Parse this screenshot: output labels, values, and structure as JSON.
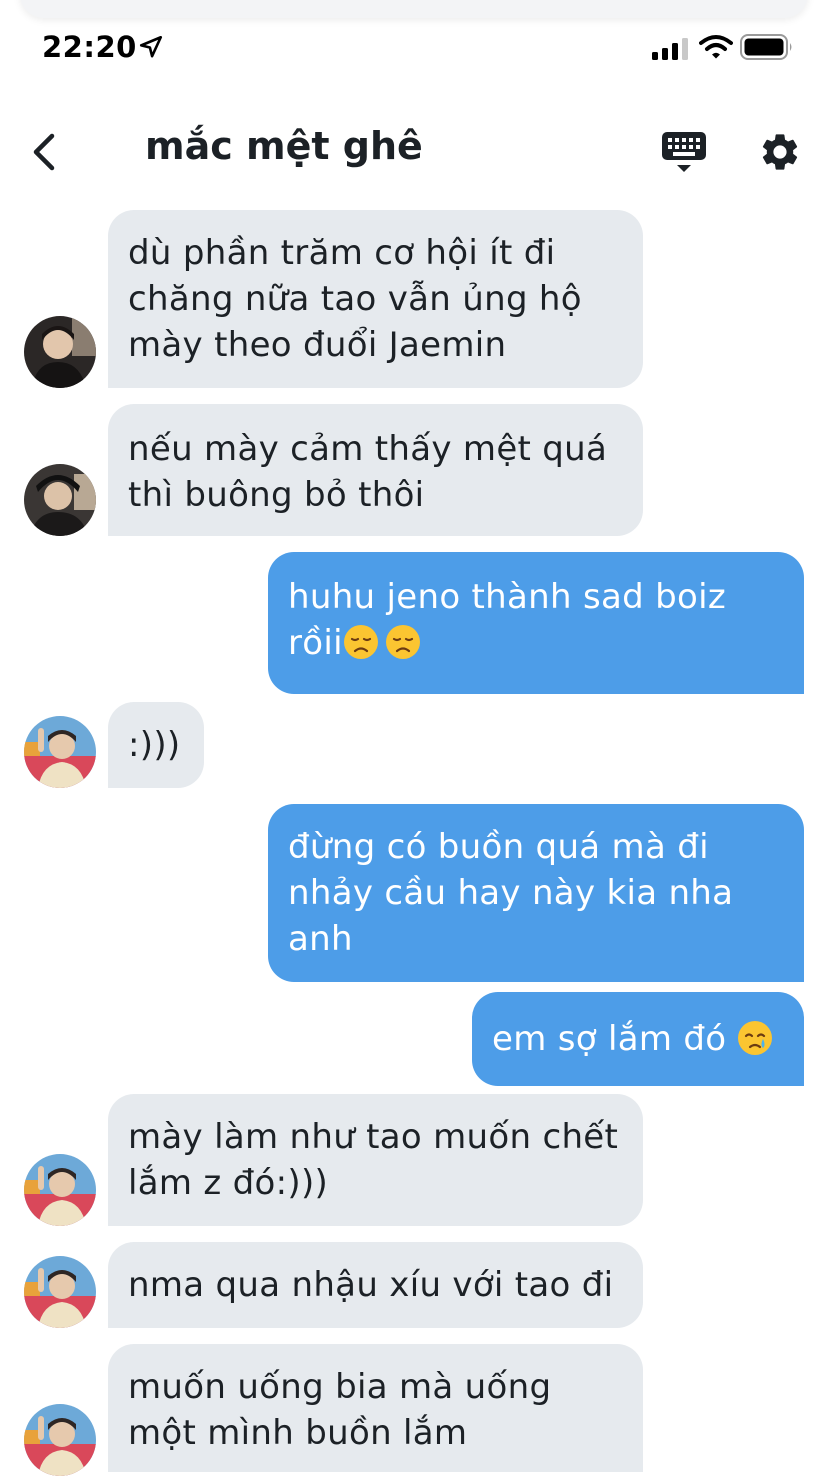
{
  "status_bar": {
    "time": "22:20",
    "location_icon": "location-arrow-icon",
    "signal_icon": "cell-signal-icon",
    "wifi_icon": "wifi-icon",
    "battery_icon": "battery-icon"
  },
  "header": {
    "title": "mắc mệt ghê",
    "back_icon": "chevron-left-icon",
    "keyboard_icon": "keyboard-icon",
    "settings_icon": "gear-icon"
  },
  "colors": {
    "sent_bubble": "#4d9de8",
    "received_bubble": "#e6eaee",
    "text": "#1c2126"
  },
  "messages": [
    {
      "side": "received",
      "text": "dù phần trăm cơ hội ít đi\nchăng nữa tao vẫn ủng hộ\nmày theo đuổi Jaemin",
      "avatar": true
    },
    {
      "side": "received",
      "text": "nếu mày cảm thấy mệt quá\nthì buông bỏ thôi",
      "avatar": true
    },
    {
      "side": "sent",
      "line1": "huhu jeno thành sad boiz",
      "line2": "rồii",
      "emoji": "disappointed-face-emoji"
    },
    {
      "side": "received",
      "text": ":)))",
      "avatar": true
    },
    {
      "side": "sent",
      "text": "đừng có buồn quá mà đi\nnhảy cầu hay này kia nha\nanh"
    },
    {
      "side": "sent",
      "text": "em sợ lắm đó",
      "emoji": "crying-face-emoji"
    },
    {
      "side": "received",
      "text": "mày làm như tao muốn chết\nlắm z đó:)))",
      "avatar": true
    },
    {
      "side": "received",
      "text": "nma qua nhậu xíu với tao đi",
      "avatar": true
    },
    {
      "side": "received",
      "text": " muốn uống bia mà uống\nmột mình buồn lắm",
      "avatar": true
    }
  ]
}
